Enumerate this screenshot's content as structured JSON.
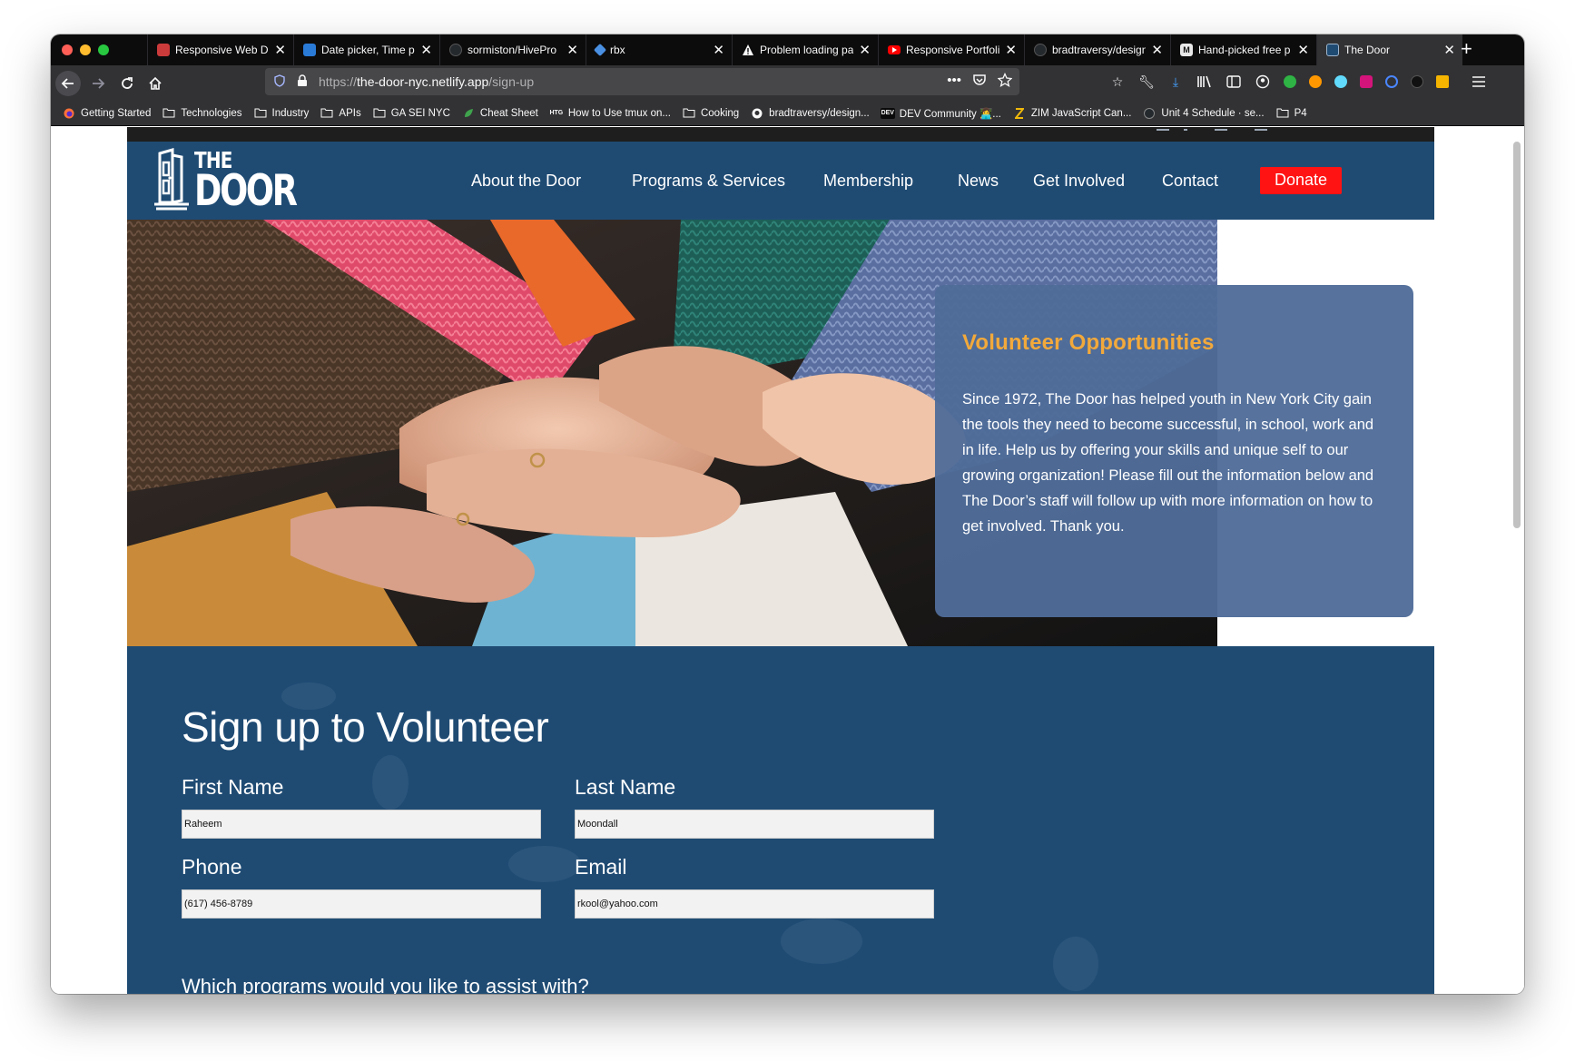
{
  "browser": {
    "tabs": [
      {
        "title": "Responsive Web Design",
        "favicon_color": "#cc3b3b",
        "favicon": "rw"
      },
      {
        "title": "Date picker, Time picker",
        "favicon_color": "#2a7bd8",
        "favicon": "d"
      },
      {
        "title": "sormiston/HivePro",
        "favicon_color": "#24292e",
        "favicon": "gh"
      },
      {
        "title": "rbx",
        "favicon_color": "#4a90e2",
        "favicon": "r"
      },
      {
        "title": "Problem loading page",
        "favicon_color": "#f9f9fa",
        "favicon": "!"
      },
      {
        "title": "Responsive Portfolio",
        "favicon_color": "#ff0000",
        "favicon": "yt"
      },
      {
        "title": "bradtraversy/design",
        "favicon_color": "#24292e",
        "favicon": "gh"
      },
      {
        "title": "Hand-picked free p",
        "favicon_color": "#e8e8e8",
        "favicon": "M"
      },
      {
        "title": "The Door",
        "favicon_color": "#1f4b73",
        "favicon": "d"
      }
    ],
    "active_tab": 8,
    "url_prefix": "https://",
    "url_host": "the-door-nyc.netlify.app",
    "url_path": "/sign-up",
    "bookmarks": [
      {
        "label": "Getting Started",
        "icon": "firefox-icon"
      },
      {
        "label": "Technologies",
        "icon": "folder-icon"
      },
      {
        "label": "Industry",
        "icon": "folder-icon"
      },
      {
        "label": "APIs",
        "icon": "folder-icon"
      },
      {
        "label": "GA SEI NYC",
        "icon": "folder-icon"
      },
      {
        "label": "Cheat Sheet",
        "icon": "leaf-icon"
      },
      {
        "label": "How to Use tmux on...",
        "icon": "htg-icon"
      },
      {
        "label": "Cooking",
        "icon": "folder-icon"
      },
      {
        "label": "bradtraversy/design...",
        "icon": "github-icon"
      },
      {
        "label": "DEV Community 👩‍💻...",
        "icon": "dev-icon"
      },
      {
        "label": "ZIM JavaScript Can...",
        "icon": "zim-icon"
      },
      {
        "label": "Unit 4 Schedule · se...",
        "icon": "github-icon"
      },
      {
        "label": "P4",
        "icon": "folder-icon"
      }
    ]
  },
  "site": {
    "logo_the": "THE",
    "logo_door": "DOOR",
    "nav": [
      "About the Door",
      "Programs & Services",
      "Membership",
      "News",
      "Get Involved",
      "Contact"
    ],
    "donate": "Donate",
    "colors": {
      "brand": "#1f4b73",
      "donate": "#ff1313",
      "accent": "#f2a93b",
      "card": "#4f6c99"
    }
  },
  "hero": {
    "title": "Volunteer Opportunities",
    "body": "Since 1972, The Door has helped youth in New York City gain the tools they need to become successful, in school, work and in life. Help us by offering your skills and unique self to our growing organization! Please fill out the information below and The Door’s staff will follow up with more information on how to get involved. Thank you."
  },
  "form": {
    "title": "Sign up to Volunteer",
    "first_name_label": "First Name",
    "first_name_value": "Raheem",
    "last_name_label": "Last Name",
    "last_name_value": "Moondall",
    "phone_label": "Phone",
    "phone_value": "(617) 456-8789",
    "email_label": "Email",
    "email_value": "rkool@yahoo.com",
    "question": "Which programs would you like to assist with?"
  }
}
